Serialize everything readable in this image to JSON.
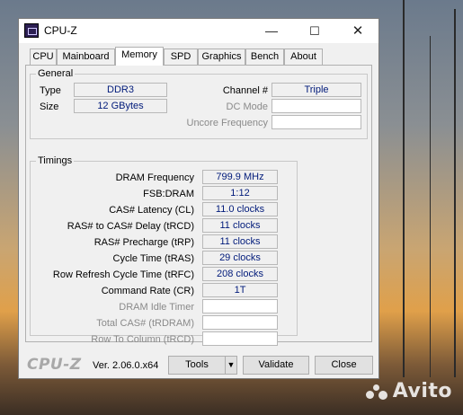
{
  "window": {
    "title": "CPU-Z"
  },
  "titlebar": {
    "minimize": "—",
    "maximize": "☐",
    "close": "✕"
  },
  "tabs": [
    {
      "label": "CPU"
    },
    {
      "label": "Mainboard"
    },
    {
      "label": "Memory"
    },
    {
      "label": "SPD"
    },
    {
      "label": "Graphics"
    },
    {
      "label": "Bench"
    },
    {
      "label": "About"
    }
  ],
  "general": {
    "title": "General",
    "type_label": "Type",
    "type_value": "DDR3",
    "size_label": "Size",
    "size_value": "12 GBytes",
    "channel_label": "Channel #",
    "channel_value": "Triple",
    "dcmode_label": "DC Mode",
    "dcmode_value": "",
    "uncore_label": "Uncore Frequency",
    "uncore_value": ""
  },
  "timings": {
    "title": "Timings",
    "rows": [
      {
        "label": "DRAM Frequency",
        "value": "799.9 MHz"
      },
      {
        "label": "FSB:DRAM",
        "value": "1:12"
      },
      {
        "label": "CAS# Latency (CL)",
        "value": "11.0 clocks"
      },
      {
        "label": "RAS# to CAS# Delay (tRCD)",
        "value": "11 clocks"
      },
      {
        "label": "RAS# Precharge (tRP)",
        "value": "11 clocks"
      },
      {
        "label": "Cycle Time (tRAS)",
        "value": "29 clocks"
      },
      {
        "label": "Row Refresh Cycle Time (tRFC)",
        "value": "208 clocks"
      },
      {
        "label": "Command Rate (CR)",
        "value": "1T"
      },
      {
        "label": "DRAM Idle Timer",
        "value": ""
      },
      {
        "label": "Total CAS# (tRDRAM)",
        "value": ""
      },
      {
        "label": "Row To Column (tRCD)",
        "value": ""
      }
    ]
  },
  "bottom": {
    "brand": "CPU-Z",
    "version": "Ver. 2.06.0.x64",
    "tools_label": "Tools",
    "tools_dropdown": "▼",
    "validate_label": "Validate",
    "close_label": "Close"
  },
  "watermark": {
    "text": "Avito"
  }
}
